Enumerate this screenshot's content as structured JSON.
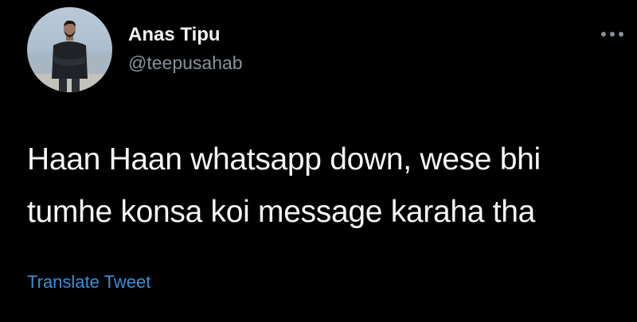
{
  "user": {
    "display_name": "Anas Tipu",
    "handle": "@teepusahab"
  },
  "tweet": {
    "lines": [
      "Haan Haan whatsapp down, wese bhi",
      "tumhe konsa koi message karaha tha"
    ]
  },
  "actions": {
    "translate_label": "Translate Tweet",
    "more_icon": "more-horizontal-icon"
  },
  "colors": {
    "background": "#000000",
    "text": "#f5f5f5",
    "handle": "#8a9199",
    "link": "#3a8fd6"
  }
}
